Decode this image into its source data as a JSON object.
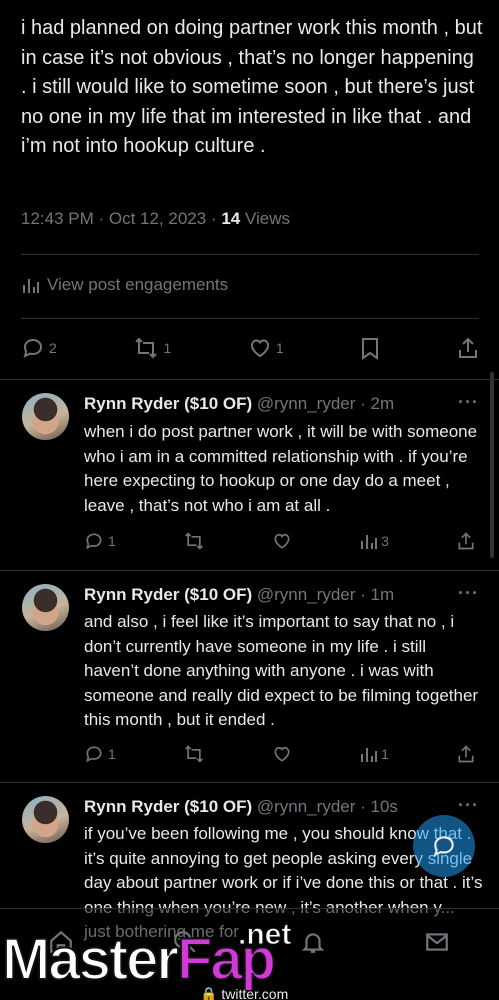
{
  "main_post": {
    "text": "i had planned on doing partner work this month , but in case it’s not obvious , that’s no longer happening . i still would like to sometime soon , but there’s just no one in my life that im interested in like that . and i’m not into hookup culture .",
    "timestamp": "12:43 PM · Oct 12, 2023 · ",
    "views_count": "14",
    "views_label": " Views",
    "engagements_label": "View post engagements",
    "stats": {
      "replies": "2",
      "reposts": "1",
      "likes": "1"
    }
  },
  "replies": [
    {
      "name": "Rynn Ryder ($10 OF)",
      "handle": "@rynn_ryder · 2m",
      "text": "when i do post partner work , it will be with someone who i am in a committed relationship with . if you’re here expecting to hookup or one day do a meet , leave , that’s not who i am at all .",
      "replies": "1",
      "reposts": "",
      "likes": "",
      "views": "3"
    },
    {
      "name": "Rynn Ryder ($10 OF)",
      "handle": "@rynn_ryder · 1m",
      "text": "and also , i feel like it’s important to say that no , i don’t currently have someone in my life . i still haven’t done anything with anyone . i was with someone and really did expect to be filming together this month , but it ended .",
      "replies": "1",
      "reposts": "",
      "likes": "",
      "views": "1"
    },
    {
      "name": "Rynn Ryder ($10 OF)",
      "handle": "@rynn_ryder · 10s",
      "text": "if you’ve been following me , you should know that . it’s quite annoying to get people asking every single day about partner work or if i’ve done this or that . it’s one thing when you’re new , it’s another when y... just bothering me for"
    }
  ],
  "watermark": {
    "master": "Master",
    "fap": "Fap",
    "net": ".net",
    "source": "twitter.com"
  },
  "colors": {
    "text": "#e7e9ea",
    "muted": "#71767b",
    "divider": "#2f3336",
    "accent": "#1d9bf0"
  }
}
